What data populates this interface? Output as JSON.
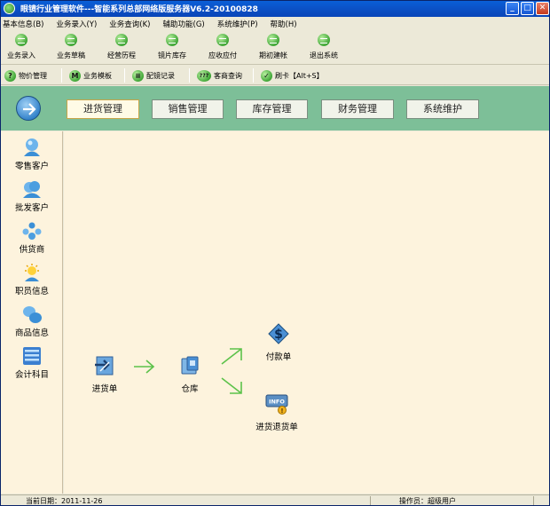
{
  "window": {
    "title": "眼镜行业管理软件---智能系列总部网络版服务器V6.2-20100828",
    "min_glyph": "_",
    "max_glyph": "□",
    "close_glyph": "✕"
  },
  "menu": [
    "基本信息(B)",
    "业务录入(Y)",
    "业务查询(K)",
    "辅助功能(G)",
    "系统维护(P)",
    "帮助(H)"
  ],
  "toolbar": {
    "items": [
      {
        "label": "业务录入",
        "icon": "entry-icon"
      },
      {
        "label": "业务草稿",
        "icon": "draft-icon"
      },
      {
        "label": "经营历程",
        "icon": "history-icon"
      },
      {
        "label": "镜片库存",
        "icon": "lens-stock-icon"
      },
      {
        "label": "应收应付",
        "icon": "receivable-icon"
      },
      {
        "label": "期初建帐",
        "icon": "opening-account-icon"
      },
      {
        "label": "退出系统",
        "icon": "exit-icon"
      }
    ]
  },
  "toolbar2": {
    "items": [
      {
        "glyph": "?",
        "label": "物价管理"
      },
      {
        "glyph": "M",
        "label": "业务模板"
      },
      {
        "glyph": "≡",
        "label": "配镜记录"
      },
      {
        "glyph": "???",
        "label": "客商查询"
      },
      {
        "glyph": "✓",
        "label": "刷卡【Alt+S】"
      }
    ]
  },
  "tabs": [
    "进货管理",
    "销售管理",
    "库存管理",
    "财务管理",
    "系统维护"
  ],
  "active_tab": "进货管理",
  "sidebar": {
    "items": [
      "零售客户",
      "批发客户",
      "供货商",
      "职员信息",
      "商品信息",
      "会计科目"
    ]
  },
  "flow": {
    "purchase": "进货单",
    "warehouse": "仓库",
    "payment": "付款单",
    "return": "进货退货单"
  },
  "status": {
    "date_label": "当前日期：2011-11-26",
    "operator_label": "操作员：超级用户"
  },
  "colors": {
    "band": "#7dbf98",
    "content": "#fdf3dd",
    "flow_arrow": "#5cc24a"
  }
}
